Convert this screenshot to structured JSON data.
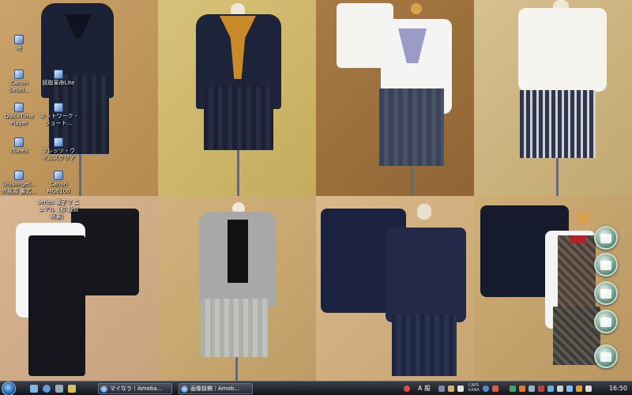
{
  "desktop": {
    "icons": [
      {
        "label": "咲"
      },
      {
        "label": "Canon Soluti..."
      },
      {
        "label": "読取革命Lite"
      },
      {
        "label": "QuickTime Player"
      },
      {
        "label": "ネットワーク - ショート..."
      },
      {
        "label": "iTunes"
      },
      {
        "label": "フレッツ・ウ イルスクリア"
      },
      {
        "label": "Unisonget..."
      },
      {
        "label": "外部周 書式..."
      },
      {
        "label": "Canon MG6100"
      },
      {
        "label": "series 電子マ ニュアル（取 扱説明書）"
      }
    ]
  },
  "taskbar": {
    "tasks": [
      {
        "label": "マイなう｜Ameba..."
      },
      {
        "label": "画像投稿｜Ameb..."
      }
    ],
    "tray": {
      "language": "A 般",
      "caps_line1": "CAPS",
      "caps_line2": "KANA",
      "clock": "16:50"
    }
  },
  "colors": {
    "taskbar": "#1c1f25",
    "accent": "#2b6fc2"
  }
}
